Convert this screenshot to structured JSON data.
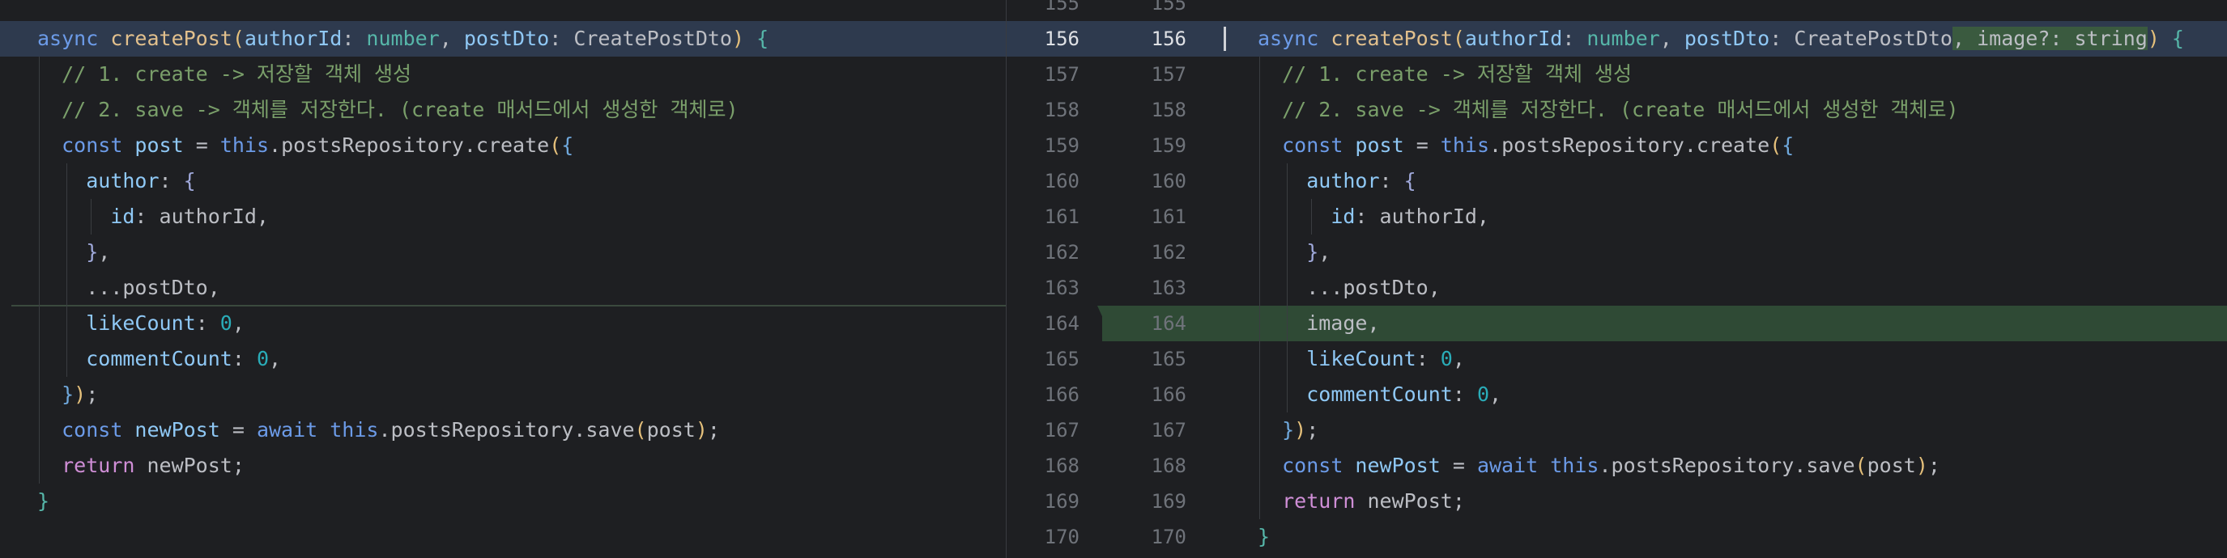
{
  "left_lines": [
    {
      "segs": [
        {
          "t": "async ",
          "c": "kw"
        },
        {
          "t": "createPost",
          "c": "fn"
        },
        {
          "t": "(",
          "c": "b1"
        },
        {
          "t": "authorId",
          "c": "par"
        },
        {
          "t": ": ",
          "c": "plain"
        },
        {
          "t": "number",
          "c": "type"
        },
        {
          "t": ", ",
          "c": "plain"
        },
        {
          "t": "postDto",
          "c": "par"
        },
        {
          "t": ": ",
          "c": "plain"
        },
        {
          "t": "CreatePostDto",
          "c": "cls"
        },
        {
          "t": ")",
          "c": "b1"
        },
        {
          "t": " {",
          "c": "type"
        }
      ]
    },
    {
      "segs": [
        {
          "t": "  // 1. create -> 저장할 객체 생성",
          "c": "cm"
        }
      ]
    },
    {
      "segs": [
        {
          "t": "  // 2. save -> 객체를 저장한다. (create 매서드에서 생성한 객체로)",
          "c": "cm"
        }
      ]
    },
    {
      "segs": [
        {
          "t": "  ",
          "c": "plain"
        },
        {
          "t": "const ",
          "c": "kw"
        },
        {
          "t": "post",
          "c": "par"
        },
        {
          "t": " = ",
          "c": "plain"
        },
        {
          "t": "this",
          "c": "kw"
        },
        {
          "t": ".postsRepository.create",
          "c": "plain"
        },
        {
          "t": "(",
          "c": "b1"
        },
        {
          "t": "{",
          "c": "b3"
        }
      ]
    },
    {
      "segs": [
        {
          "t": "    ",
          "c": "plain"
        },
        {
          "t": "author",
          "c": "par"
        },
        {
          "t": ": ",
          "c": "plain"
        },
        {
          "t": "{",
          "c": "b2"
        }
      ]
    },
    {
      "segs": [
        {
          "t": "      ",
          "c": "plain"
        },
        {
          "t": "id",
          "c": "par"
        },
        {
          "t": ": authorId,",
          "c": "plain"
        }
      ]
    },
    {
      "segs": [
        {
          "t": "    ",
          "c": "plain"
        },
        {
          "t": "}",
          "c": "b2"
        },
        {
          "t": ",",
          "c": "plain"
        }
      ]
    },
    {
      "segs": [
        {
          "t": "    ...postDto,",
          "c": "plain"
        }
      ]
    },
    {
      "segs": [
        {
          "t": "    ",
          "c": "plain"
        },
        {
          "t": "likeCount",
          "c": "par"
        },
        {
          "t": ": ",
          "c": "plain"
        },
        {
          "t": "0",
          "c": "num"
        },
        {
          "t": ",",
          "c": "plain"
        }
      ]
    },
    {
      "segs": [
        {
          "t": "    ",
          "c": "plain"
        },
        {
          "t": "commentCount",
          "c": "par"
        },
        {
          "t": ": ",
          "c": "plain"
        },
        {
          "t": "0",
          "c": "num"
        },
        {
          "t": ",",
          "c": "plain"
        }
      ]
    },
    {
      "segs": [
        {
          "t": "  ",
          "c": "plain"
        },
        {
          "t": "}",
          "c": "b3"
        },
        {
          "t": ")",
          "c": "b1"
        },
        {
          "t": ";",
          "c": "plain"
        }
      ]
    },
    {
      "segs": [
        {
          "t": "  ",
          "c": "plain"
        },
        {
          "t": "const ",
          "c": "kw"
        },
        {
          "t": "newPost",
          "c": "par"
        },
        {
          "t": " = ",
          "c": "plain"
        },
        {
          "t": "await ",
          "c": "kw"
        },
        {
          "t": "this",
          "c": "kw"
        },
        {
          "t": ".postsRepository.save",
          "c": "plain"
        },
        {
          "t": "(",
          "c": "b1"
        },
        {
          "t": "post",
          "c": "plain"
        },
        {
          "t": ")",
          "c": "b1"
        },
        {
          "t": ";",
          "c": "plain"
        }
      ]
    },
    {
      "segs": [
        {
          "t": "  ",
          "c": "plain"
        },
        {
          "t": "return ",
          "c": "kw2"
        },
        {
          "t": "newPost;",
          "c": "plain"
        }
      ]
    },
    {
      "segs": [
        {
          "t": "}",
          "c": "type"
        }
      ]
    }
  ],
  "right_lines": [
    {
      "segs": []
    },
    {
      "segs": [
        {
          "t": "async ",
          "c": "kw"
        },
        {
          "t": "createPost",
          "c": "fn"
        },
        {
          "t": "(",
          "c": "b1"
        },
        {
          "t": "authorId",
          "c": "par"
        },
        {
          "t": ": ",
          "c": "plain"
        },
        {
          "t": "number",
          "c": "type"
        },
        {
          "t": ", ",
          "c": "plain"
        },
        {
          "t": "postDto",
          "c": "par"
        },
        {
          "t": ": ",
          "c": "plain"
        },
        {
          "t": "CreatePostDto",
          "c": "cls"
        },
        {
          "t": ", image?: string",
          "c": "plain",
          "hl": true
        },
        {
          "t": ")",
          "c": "b1"
        },
        {
          "t": " {",
          "c": "type"
        }
      ]
    },
    {
      "segs": [
        {
          "t": "  // 1. create -> 저장할 객체 생성",
          "c": "cm"
        }
      ]
    },
    {
      "segs": [
        {
          "t": "  // 2. save -> 객체를 저장한다. (create 매서드에서 생성한 객체로)",
          "c": "cm"
        }
      ]
    },
    {
      "segs": [
        {
          "t": "  ",
          "c": "plain"
        },
        {
          "t": "const ",
          "c": "kw"
        },
        {
          "t": "post",
          "c": "par"
        },
        {
          "t": " = ",
          "c": "plain"
        },
        {
          "t": "this",
          "c": "kw"
        },
        {
          "t": ".postsRepository.create",
          "c": "plain"
        },
        {
          "t": "(",
          "c": "b1"
        },
        {
          "t": "{",
          "c": "b3"
        }
      ]
    },
    {
      "segs": [
        {
          "t": "    ",
          "c": "plain"
        },
        {
          "t": "author",
          "c": "par"
        },
        {
          "t": ": ",
          "c": "plain"
        },
        {
          "t": "{",
          "c": "b2"
        }
      ]
    },
    {
      "segs": [
        {
          "t": "      ",
          "c": "plain"
        },
        {
          "t": "id",
          "c": "par"
        },
        {
          "t": ": authorId,",
          "c": "plain"
        }
      ]
    },
    {
      "segs": [
        {
          "t": "    ",
          "c": "plain"
        },
        {
          "t": "}",
          "c": "b2"
        },
        {
          "t": ",",
          "c": "plain"
        }
      ]
    },
    {
      "segs": [
        {
          "t": "    ...postDto,",
          "c": "plain"
        }
      ]
    },
    {
      "segs": [
        {
          "t": "    image,",
          "c": "plain"
        }
      ]
    },
    {
      "segs": [
        {
          "t": "    ",
          "c": "plain"
        },
        {
          "t": "likeCount",
          "c": "par"
        },
        {
          "t": ": ",
          "c": "plain"
        },
        {
          "t": "0",
          "c": "num"
        },
        {
          "t": ",",
          "c": "plain"
        }
      ]
    },
    {
      "segs": [
        {
          "t": "    ",
          "c": "plain"
        },
        {
          "t": "commentCount",
          "c": "par"
        },
        {
          "t": ": ",
          "c": "plain"
        },
        {
          "t": "0",
          "c": "num"
        },
        {
          "t": ",",
          "c": "plain"
        }
      ]
    },
    {
      "segs": [
        {
          "t": "  ",
          "c": "plain"
        },
        {
          "t": "}",
          "c": "b3"
        },
        {
          "t": ")",
          "c": "b1"
        },
        {
          "t": ";",
          "c": "plain"
        }
      ]
    },
    {
      "segs": [
        {
          "t": "  ",
          "c": "plain"
        },
        {
          "t": "const ",
          "c": "kw"
        },
        {
          "t": "newPost",
          "c": "par"
        },
        {
          "t": " = ",
          "c": "plain"
        },
        {
          "t": "await ",
          "c": "kw"
        },
        {
          "t": "this",
          "c": "kw"
        },
        {
          "t": ".postsRepository.save",
          "c": "plain"
        },
        {
          "t": "(",
          "c": "b1"
        },
        {
          "t": "post",
          "c": "plain"
        },
        {
          "t": ")",
          "c": "b1"
        },
        {
          "t": ";",
          "c": "plain"
        }
      ]
    },
    {
      "segs": [
        {
          "t": "  ",
          "c": "plain"
        },
        {
          "t": "return ",
          "c": "kw2"
        },
        {
          "t": "newPost;",
          "c": "plain"
        }
      ]
    },
    {
      "segs": [
        {
          "t": "}",
          "c": "type"
        }
      ]
    }
  ],
  "gutter_rows": [
    {
      "left": "155",
      "right": "155",
      "kind": "normal"
    },
    {
      "left": "156",
      "right": "156",
      "kind": "changed"
    },
    {
      "left": "157",
      "right": "157",
      "kind": "normal"
    },
    {
      "left": "158",
      "right": "158",
      "kind": "normal"
    },
    {
      "left": "159",
      "right": "159",
      "kind": "normal"
    },
    {
      "left": "160",
      "right": "160",
      "kind": "normal"
    },
    {
      "left": "161",
      "right": "161",
      "kind": "normal"
    },
    {
      "left": "162",
      "right": "162",
      "kind": "normal"
    },
    {
      "left": "163",
      "right": "163",
      "kind": "normal"
    },
    {
      "left": "164",
      "right": "164",
      "kind": "added"
    },
    {
      "left": "165",
      "right": "165",
      "kind": "normal"
    },
    {
      "left": "166",
      "right": "166",
      "kind": "normal"
    },
    {
      "left": "167",
      "right": "167",
      "kind": "normal"
    },
    {
      "left": "168",
      "right": "168",
      "kind": "normal"
    },
    {
      "left": "169",
      "right": "169",
      "kind": "normal"
    },
    {
      "left": "170",
      "right": "170",
      "kind": "normal"
    }
  ],
  "colors": {
    "background": "#1e1f22",
    "changed_line": "#2e3a4e",
    "added_line": "#2f4a35",
    "keyword": "#6c9be8",
    "comment": "#7a9f6a",
    "function": "#e2c08d",
    "number": "#2aacb8"
  }
}
